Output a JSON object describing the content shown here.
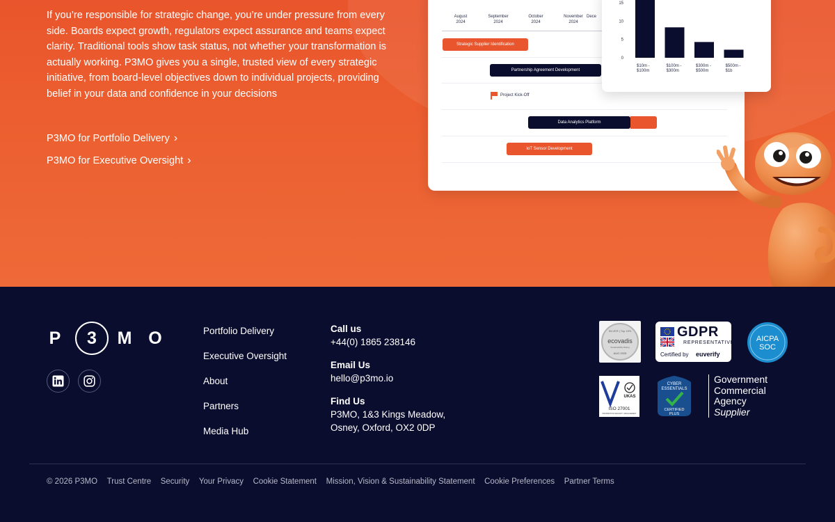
{
  "hero": {
    "body": "If you’re responsible for strategic change, you’re under pressure from every side. Boards expect growth, regulators expect assurance and teams expect clarity. Traditional tools show task status, not whether your transformation is actually working. P3MO gives you a single, trusted view of every strategic initiative, from board-level objectives down to individual projects, providing belief in your data and confidence in your decisions",
    "links": [
      "P3MO for Portfolio Delivery",
      "P3MO for Executive Oversight"
    ]
  },
  "gantt": {
    "months": [
      {
        "m": "August",
        "y": "2024"
      },
      {
        "m": "September",
        "y": "2024"
      },
      {
        "m": "October",
        "y": "2024"
      },
      {
        "m": "November",
        "y": "2024"
      },
      {
        "m": "Dece",
        "y": ""
      }
    ],
    "tasks": {
      "t1": "Strategic Supplier Identification",
      "t2": "Partnership Agreement Development",
      "t3": "Project Kick-Off",
      "t4": "Data Analytics Platform",
      "t5": "IoT Sensor Development"
    }
  },
  "chart_data": {
    "type": "bar",
    "categories": [
      "$10m - $100m",
      "$100m - $300m",
      "$300m - $500m",
      "$500m - $1b"
    ],
    "values": [
      17,
      8.3,
      4.3,
      2.2
    ],
    "ylim": [
      0,
      15
    ],
    "yticks": [
      0,
      5,
      10,
      15
    ],
    "color": "#0b0d2e"
  },
  "footer": {
    "logo": {
      "p": "P",
      "three": "3",
      "m": "M",
      "o": "O"
    },
    "nav": [
      "Portfolio Delivery",
      "Executive Oversight",
      "About",
      "Partners",
      "Media Hub"
    ],
    "contact": {
      "call_label": "Call us",
      "phone": "+44(0) 1865 238146",
      "email_label": "Email Us",
      "email": "hello@p3mo.io",
      "find_label": "Find Us",
      "address1": "P3MO, 1&3 Kings Meadow,",
      "address2": "Osney, Oxford, OX2 0DP"
    },
    "badges": {
      "ecovadis": {
        "top": "SILVER | Top 15%",
        "name": "ecovadis",
        "sub": "Sustainability Rating",
        "date": "AUG 2025"
      },
      "gdpr": {
        "title": "GDPR",
        "rep": "REPRESENTATIVE",
        "cert": "Certified by",
        "brand": "euverify"
      },
      "aicpa": {
        "line1": "AICPA",
        "line2": "SOC"
      },
      "ukas": {
        "iso": "ISO 27001",
        "sub": "INFORMATION SECURITY MANAGEMENT",
        "ukas": "UKAS"
      },
      "cyber": {
        "line1": "CYBER",
        "line2": "ESSENTIALS",
        "line3": "CERTIFIED",
        "line4": "PLUS"
      },
      "gov": {
        "line1": "Government",
        "line2": "Commercial",
        "line3": "Agency",
        "line4": "Supplier"
      }
    },
    "legal": [
      "© 2026 P3MO",
      "Trust Centre",
      "Security",
      "Your Privacy",
      "Cookie Statement",
      "Mission, Vision & Sustainability Statement",
      "Cookie Preferences",
      "Partner Terms"
    ]
  }
}
